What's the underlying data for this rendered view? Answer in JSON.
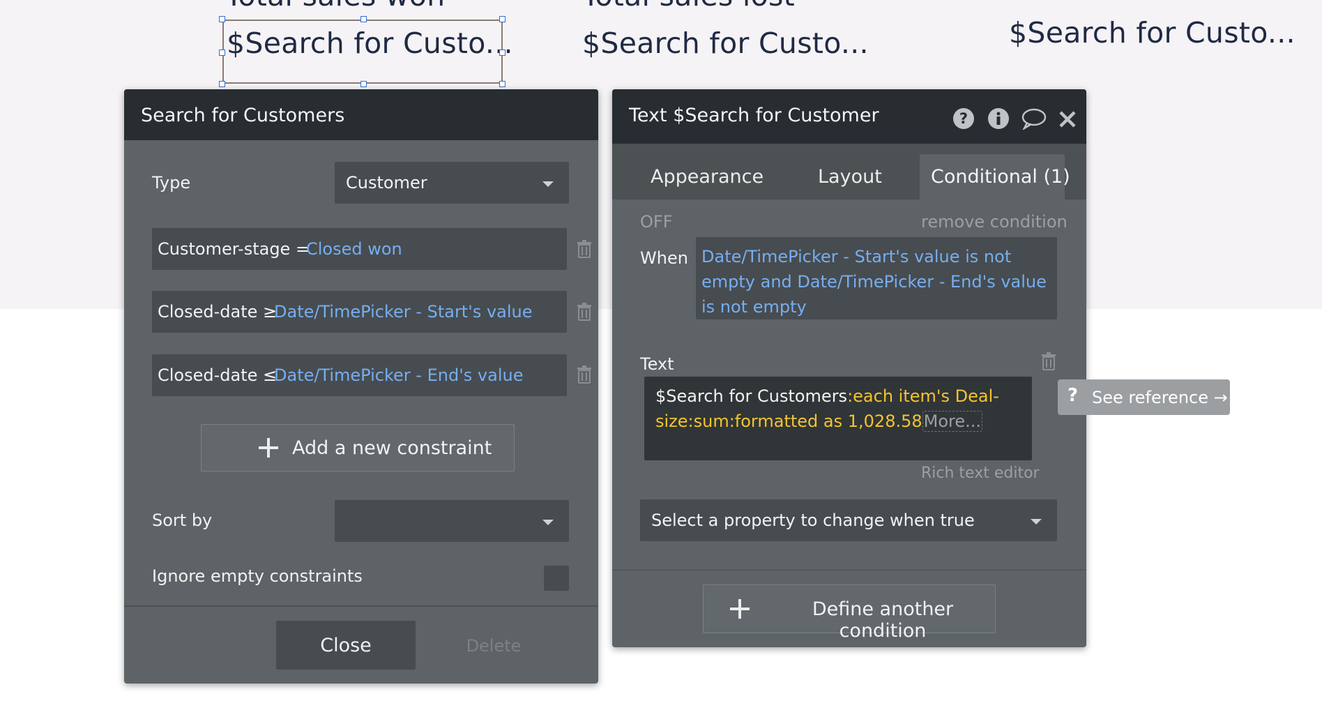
{
  "canvas": {
    "heading_won": "Total sales won",
    "heading_lost": "Total sales lost",
    "text_1": "$Search for Custo...",
    "text_2": "$Search for Custo...",
    "text_3": "$Search for Custo..."
  },
  "search_panel": {
    "title": "Search for Customers",
    "type_label": "Type",
    "type_value": "Customer",
    "constraints": [
      {
        "key": "Customer-stage = ",
        "value": "Closed won"
      },
      {
        "key": "Closed-date ≥ ",
        "value": "Date/TimePicker - Start's value"
      },
      {
        "key": "Closed-date ≤ ",
        "value": "Date/TimePicker - End's value"
      }
    ],
    "add_constraint_label": "Add a new constraint",
    "sort_by_label": "Sort by",
    "sort_by_value": "",
    "ignore_empty_label": "Ignore empty constraints",
    "ignore_empty_checked": false,
    "close_label": "Close",
    "delete_label": "Delete"
  },
  "property_panel": {
    "title": "Text $Search for Customer",
    "tabs": [
      "Appearance",
      "Layout",
      "Conditional (1)"
    ],
    "active_tab": "Conditional (1)",
    "off_label": "OFF",
    "remove_condition_label": "remove condition",
    "when_label": "When",
    "when_value": "Date/TimePicker - Start's value is not empty and Date/TimePicker - End's value is not empty",
    "text_label": "Text",
    "text_value_plain": "$Search for Customers",
    "text_value_expr": ":each item's Deal-size:sum:formatted as 1,028.58",
    "more_label": "More...",
    "rich_text_label": "Rich text editor",
    "select_property_placeholder": "Select a property to change when true",
    "define_condition_label": "Define another condition"
  },
  "reference_button": {
    "icon": "question-icon",
    "label": "See reference →"
  },
  "colors": {
    "panel_bg": "#5d6366",
    "header_bg": "#272d31",
    "input_bg": "#474c50",
    "link_blue": "#76aef0",
    "expression_yellow": "#f5c42c",
    "selection_blue": "#2f6de1"
  }
}
